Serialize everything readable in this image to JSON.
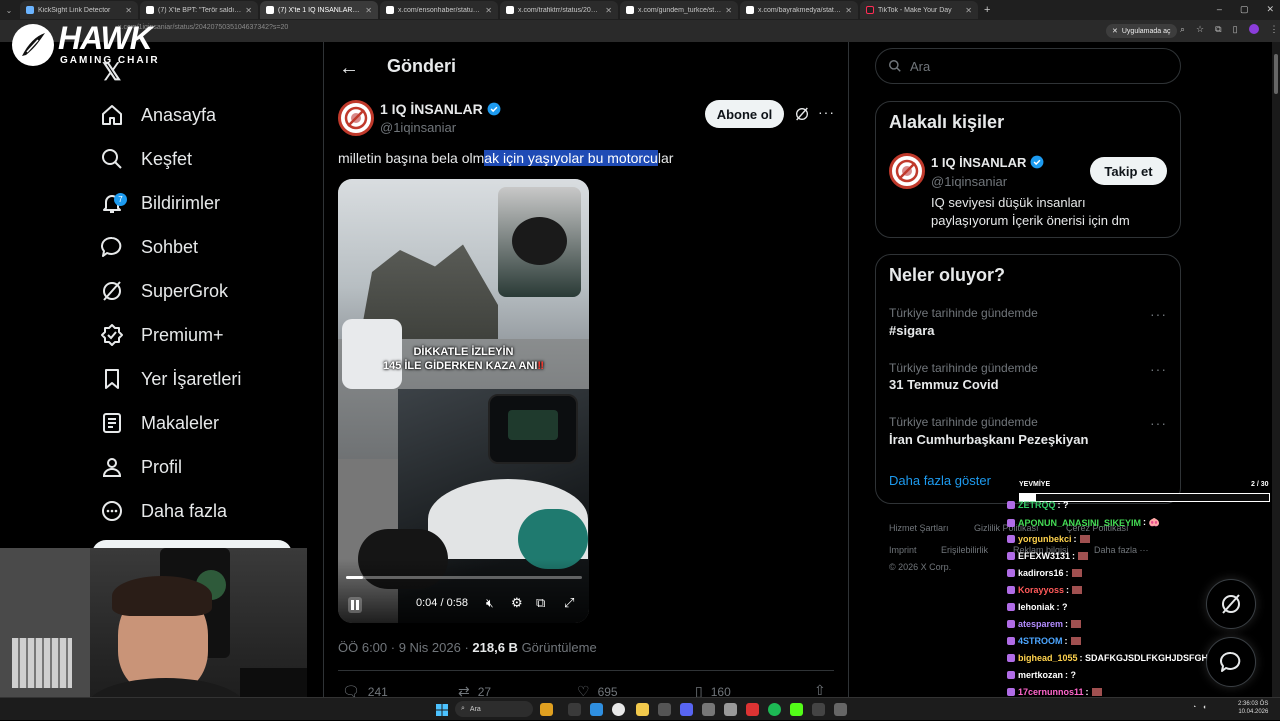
{
  "browser": {
    "tabs": [
      {
        "title": "KickSight Link Detector",
        "active": false
      },
      {
        "title": "(7) X'te BPT: \"Terör saldırısı sonr",
        "active": false
      },
      {
        "title": "(7) X'te 1 IQ İNSANLAR: \"milletin",
        "active": true
      },
      {
        "title": "x.com/ensonhaber/status/2042",
        "active": false
      },
      {
        "title": "x.com/trafiktrr/status/204232816",
        "active": false
      },
      {
        "title": "x.com/gundem_turkce/status/20",
        "active": false
      },
      {
        "title": "x.com/bayrakmedya/status/204",
        "active": false
      },
      {
        "title": "TikTok - Make Your Day",
        "active": false
      }
    ],
    "url": "x.com/1iqinsaniar/status/2042075035104637342?s=20",
    "open_app_label": "Uygulamada aç"
  },
  "overlay": {
    "logo_big": "HAWK",
    "logo_small": "GAMING CHAIR"
  },
  "sidebar": {
    "items": [
      {
        "label": "Anasayfa",
        "icon": "home-icon"
      },
      {
        "label": "Keşfet",
        "icon": "search-icon"
      },
      {
        "label": "Bildirimler",
        "icon": "bell-icon",
        "badge": "7"
      },
      {
        "label": "Sohbet",
        "icon": "chat-icon"
      },
      {
        "label": "SuperGrok",
        "icon": "grok-icon"
      },
      {
        "label": "Premium+",
        "icon": "premium-icon"
      },
      {
        "label": "Yer İşaretleri",
        "icon": "bookmark-icon"
      },
      {
        "label": "Makaleler",
        "icon": "article-icon"
      },
      {
        "label": "Profil",
        "icon": "profile-icon"
      },
      {
        "label": "Daha fazla",
        "icon": "more-icon"
      }
    ]
  },
  "post": {
    "header_title": "Gönderi",
    "author_name": "1 IQ İNSANLAR",
    "author_handle": "@1iqinsaniar",
    "subscribe_label": "Abone ol",
    "text_before": "milletin başına bela olm",
    "text_highlight": "ak için yaşıyolar bu motorcu",
    "text_after": "lar",
    "video_caption_line1": "DİKKATLE İZLEYİN",
    "video_caption_line2": "145 İLE GİDERKEN KAZA ANI",
    "video_time": "0:04 / 0:58",
    "video_progress": 0.07,
    "meta_time": "ÖÖ 6:00 · 9 Nis 2026 · ",
    "meta_views": "218,6 B",
    "meta_views_label": " Görüntüleme",
    "actions": {
      "replies": "241",
      "reposts": "27",
      "likes": "695",
      "bookmarks": "160"
    }
  },
  "right": {
    "search_placeholder": "Ara",
    "related_title": "Alakalı kişiler",
    "related_user": {
      "name": "1 IQ İNSANLAR",
      "handle": "@1iqinsaniar",
      "bio": "IQ seviyesi düşük insanları paylaşıyorum İçerik önerisi için dm",
      "follow_label": "Takip et"
    },
    "trending_title": "Neler oluyor?",
    "trends": [
      {
        "context": "Türkiye tarihinde gündemde",
        "name": "#sigara"
      },
      {
        "context": "Türkiye tarihinde gündemde",
        "name": "31 Temmuz Covid"
      },
      {
        "context": "Türkiye tarihinde gündemde",
        "name": "İran Cumhurbaşkanı Pezeşkiyan"
      }
    ],
    "show_more": "Daha fazla göster",
    "footer": {
      "links1": [
        "Hizmet Şartları",
        "Gizlilik Politikası",
        "Çerez Politikası"
      ],
      "links2": [
        "Imprint",
        "Erişilebilirlik",
        "Reklam bilgisi",
        "Daha fazla ···"
      ],
      "copyright": "© 2026 X Corp."
    }
  },
  "stream": {
    "goal_label": "YEVMİYE",
    "goal_count": "2 / 30",
    "goal_progress": 0.066,
    "chat": [
      {
        "user": "ZETRQQ",
        "color": "#33cc66",
        "msg": "?"
      },
      {
        "user": "APONUN_ANASINI_SIKEYIM",
        "color": "#44dd55",
        "msg": "🐽"
      },
      {
        "user": "yorgunbekci",
        "color": "#ffd34d",
        "msg": ""
      },
      {
        "user": "EFEXW3131",
        "color": "#ffffff",
        "msg": ""
      },
      {
        "user": "kadirors16",
        "color": "#ffffff",
        "msg": ""
      },
      {
        "user": "Korayyoss",
        "color": "#ff5a5a",
        "msg": ""
      },
      {
        "user": "lehoniak",
        "color": "#ffffff",
        "msg": "?"
      },
      {
        "user": "atesparem",
        "color": "#b38cff",
        "msg": ""
      },
      {
        "user": "4STROOM",
        "color": "#4da6ff",
        "msg": ""
      },
      {
        "user": "bighead_1055",
        "color": "#ffd34d",
        "msg": "SDAFKGJSDLFKGHJDSFGH"
      },
      {
        "user": "mertkozan",
        "color": "#ffffff",
        "msg": "?"
      },
      {
        "user": "17cernunnos11",
        "color": "#ff66cc",
        "msg": ""
      },
      {
        "user": "ittz3",
        "color": "#ff5a5a",
        "msg": ""
      }
    ]
  },
  "taskbar": {
    "search_label": "Ara",
    "time": "2:36:03 ÖS",
    "date": "10.04.2026"
  },
  "colors": {
    "accent": "#1d9bf0",
    "highlight": "#1f4bb5",
    "bg": "#000000",
    "border": "#2f3336"
  }
}
